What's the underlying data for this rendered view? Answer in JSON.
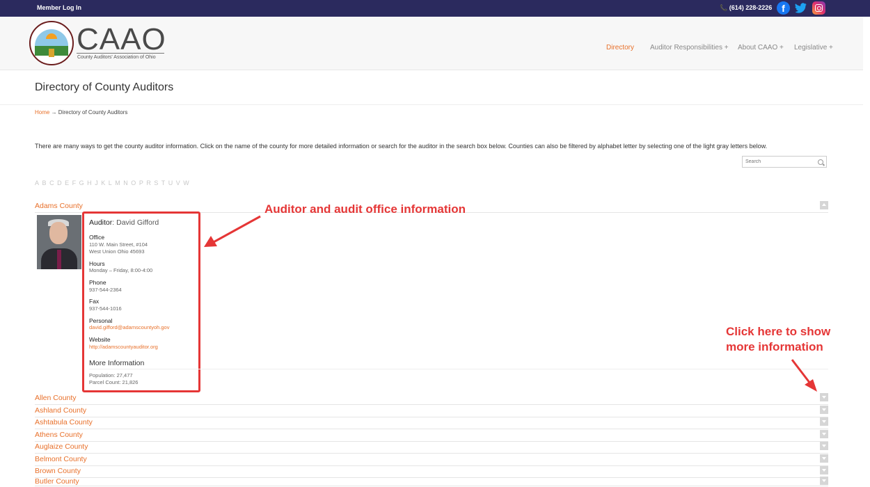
{
  "topbar": {
    "login": "Member Log In",
    "phone": "📞 (614) 228-2226",
    "icons": [
      "facebook-icon",
      "twitter-icon",
      "instagram-icon"
    ]
  },
  "header": {
    "logo_text": "CAAO",
    "logo_sub": "County Auditors' Association of Ohio",
    "nav": [
      "Directory",
      "Auditor Responsibilities +",
      "About CAAO +",
      "Legislative +"
    ]
  },
  "page": {
    "title": "Directory of County Auditors",
    "breadcrumb_home": "Home",
    "breadcrumb_rest": " → Directory of County Auditors",
    "intro": "There are many ways to get the county auditor information. Click on the name of the county for more detailed information or search for the auditor in the search box below. Counties can also be filtered by alphabet letter by selecting one of the light gray letters below.",
    "search_placeholder": "Search"
  },
  "alphabet": [
    "A",
    "B",
    "C",
    "D",
    "E",
    "F",
    "G",
    "H",
    "J",
    "K",
    "L",
    "M",
    "N",
    "O",
    "P",
    "R",
    "S",
    "T",
    "U",
    "V",
    "W"
  ],
  "expanded": {
    "county": "Adams County",
    "auditor_label": "Auditor",
    "auditor_name": ": David Gifford",
    "office_label": "Office",
    "office_line1": "110 W. Main Street, #104",
    "office_line2": "West Union Ohio 45693",
    "hours_label": "Hours",
    "hours": "Monday – Friday, 8:00-4:00",
    "phone_label": "Phone",
    "phone": "937-544-2364",
    "fax_label": "Fax",
    "fax": "937-544-1016",
    "personal_label": "Personal",
    "personal": "david.gifford@adamscountyoh.gov",
    "website_label": "Website",
    "website": "http://adamscountyauditor.org",
    "more_label": "More Information",
    "population": "Population: 27,477",
    "parcels": "Parcel Count: 21,826"
  },
  "counties": [
    "Allen County",
    "Ashland County",
    "Ashtabula County",
    "Athens County",
    "Auglaize County",
    "Belmont County",
    "Brown County",
    "Butler County"
  ],
  "annotations": {
    "info": "Auditor and audit office information",
    "toggle_line1": "Click here to show",
    "toggle_line2": "more information"
  },
  "colors": {
    "accent": "#e8702a",
    "topbar": "#2b2a5e",
    "annotation": "#e53636"
  }
}
